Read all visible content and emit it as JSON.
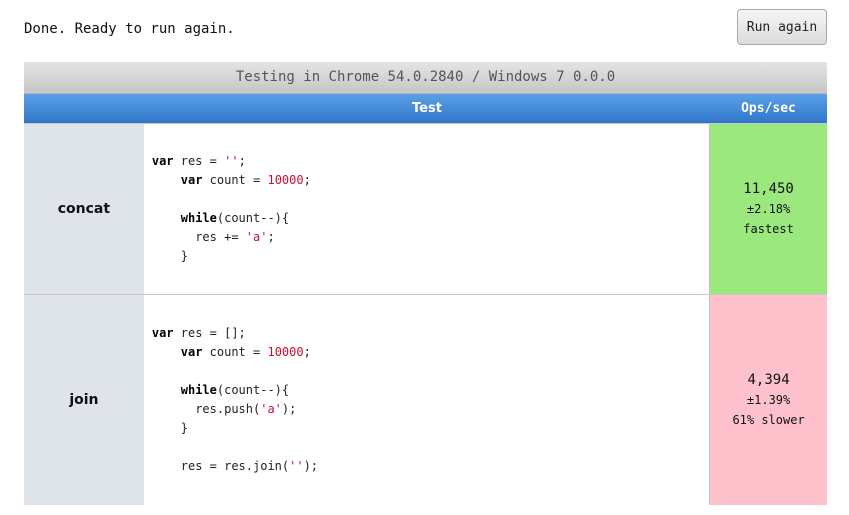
{
  "status_text": "Done. Ready to run again.",
  "run_button_label": "Run again",
  "caption": "Testing in Chrome 54.0.2840 / Windows 7 0.0.0",
  "headers": {
    "test": "Test",
    "ops": "Ops/sec"
  },
  "rows": [
    {
      "label": "concat",
      "ops": "11,450",
      "error": "±2.18%",
      "rank": "fastest",
      "status_color": "#9be87e",
      "code_lines": [
        "var res = '';",
        "    var count = 10000;",
        "",
        "    while(count--){",
        "      res += 'a';",
        "    }"
      ]
    },
    {
      "label": "join",
      "ops": "4,394",
      "error": "±1.39%",
      "rank": "61% slower",
      "status_color": "#ffc2cc",
      "code_lines": [
        "var res = [];",
        "    var count = 10000;",
        "",
        "    while(count--){",
        "      res.push('a');",
        "    }",
        "",
        "    res = res.join('');"
      ]
    }
  ],
  "colors": {
    "header_blue": "#3a82d6",
    "fastest_green": "#9be87e",
    "slower_pink": "#ffc2cc",
    "label_bg": "#dfe4ea"
  }
}
